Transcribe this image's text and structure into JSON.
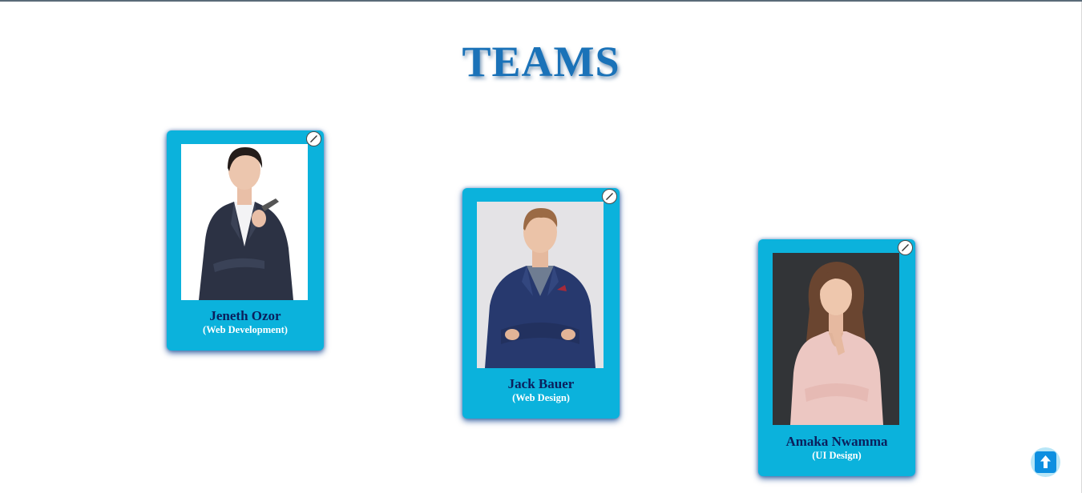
{
  "page": {
    "title": "TEAMS"
  },
  "members": [
    {
      "name": "Jeneth Ozor",
      "role": "(Web Development)",
      "photo": "woman-in-navy-suit-portrait",
      "edit_icon": "pencil-icon"
    },
    {
      "name": "Jack Bauer",
      "role": "(Web Design)",
      "photo": "man-in-blue-blazer-portrait",
      "edit_icon": "pencil-icon"
    },
    {
      "name": "Amaka Nwamma",
      "role": "(UI Design)",
      "photo": "woman-in-pink-blouse-portrait",
      "edit_icon": "pencil-icon"
    }
  ],
  "scroll_top_button": {
    "icon": "arrow-up-icon"
  },
  "colors": {
    "title": "#1a72b8",
    "card_background": "#0bb2dc",
    "member_name": "#0b1f5c",
    "member_role": "#ffffff",
    "scroll_top_button": "#0d8fe0"
  }
}
